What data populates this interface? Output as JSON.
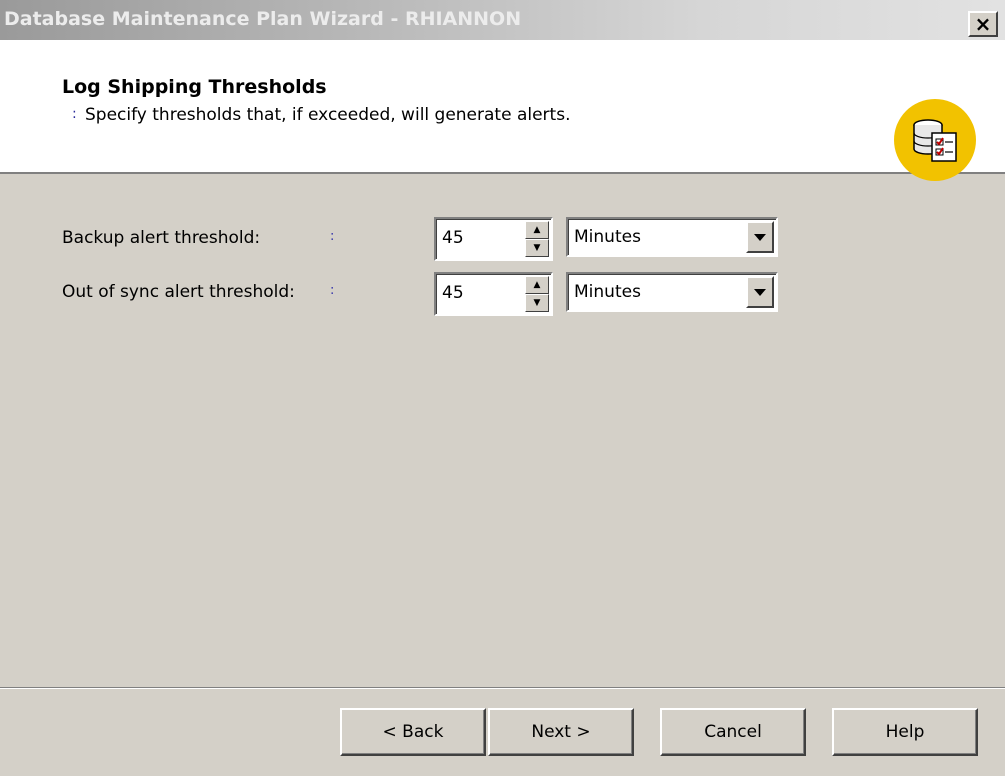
{
  "window": {
    "title": "Database Maintenance Plan Wizard - RHIANNON",
    "close_label": "×"
  },
  "header": {
    "title": "Log Shipping Thresholds",
    "subtitle": "Specify thresholds that, if exceeded, will generate alerts.",
    "icon": "database-checklist-icon"
  },
  "fields": {
    "backup": {
      "label": "Backup alert threshold:",
      "value": "45",
      "unit": "Minutes"
    },
    "sync": {
      "label": "Out of sync alert threshold:",
      "value": "45",
      "unit": "Minutes"
    }
  },
  "buttons": {
    "back": "< Back",
    "next": "Next >",
    "cancel": "Cancel",
    "help": "Help"
  },
  "colors": {
    "dialog_bg": "#d4d0c8",
    "header_bg": "#ffffff",
    "icon_yellow": "#f2c200"
  }
}
